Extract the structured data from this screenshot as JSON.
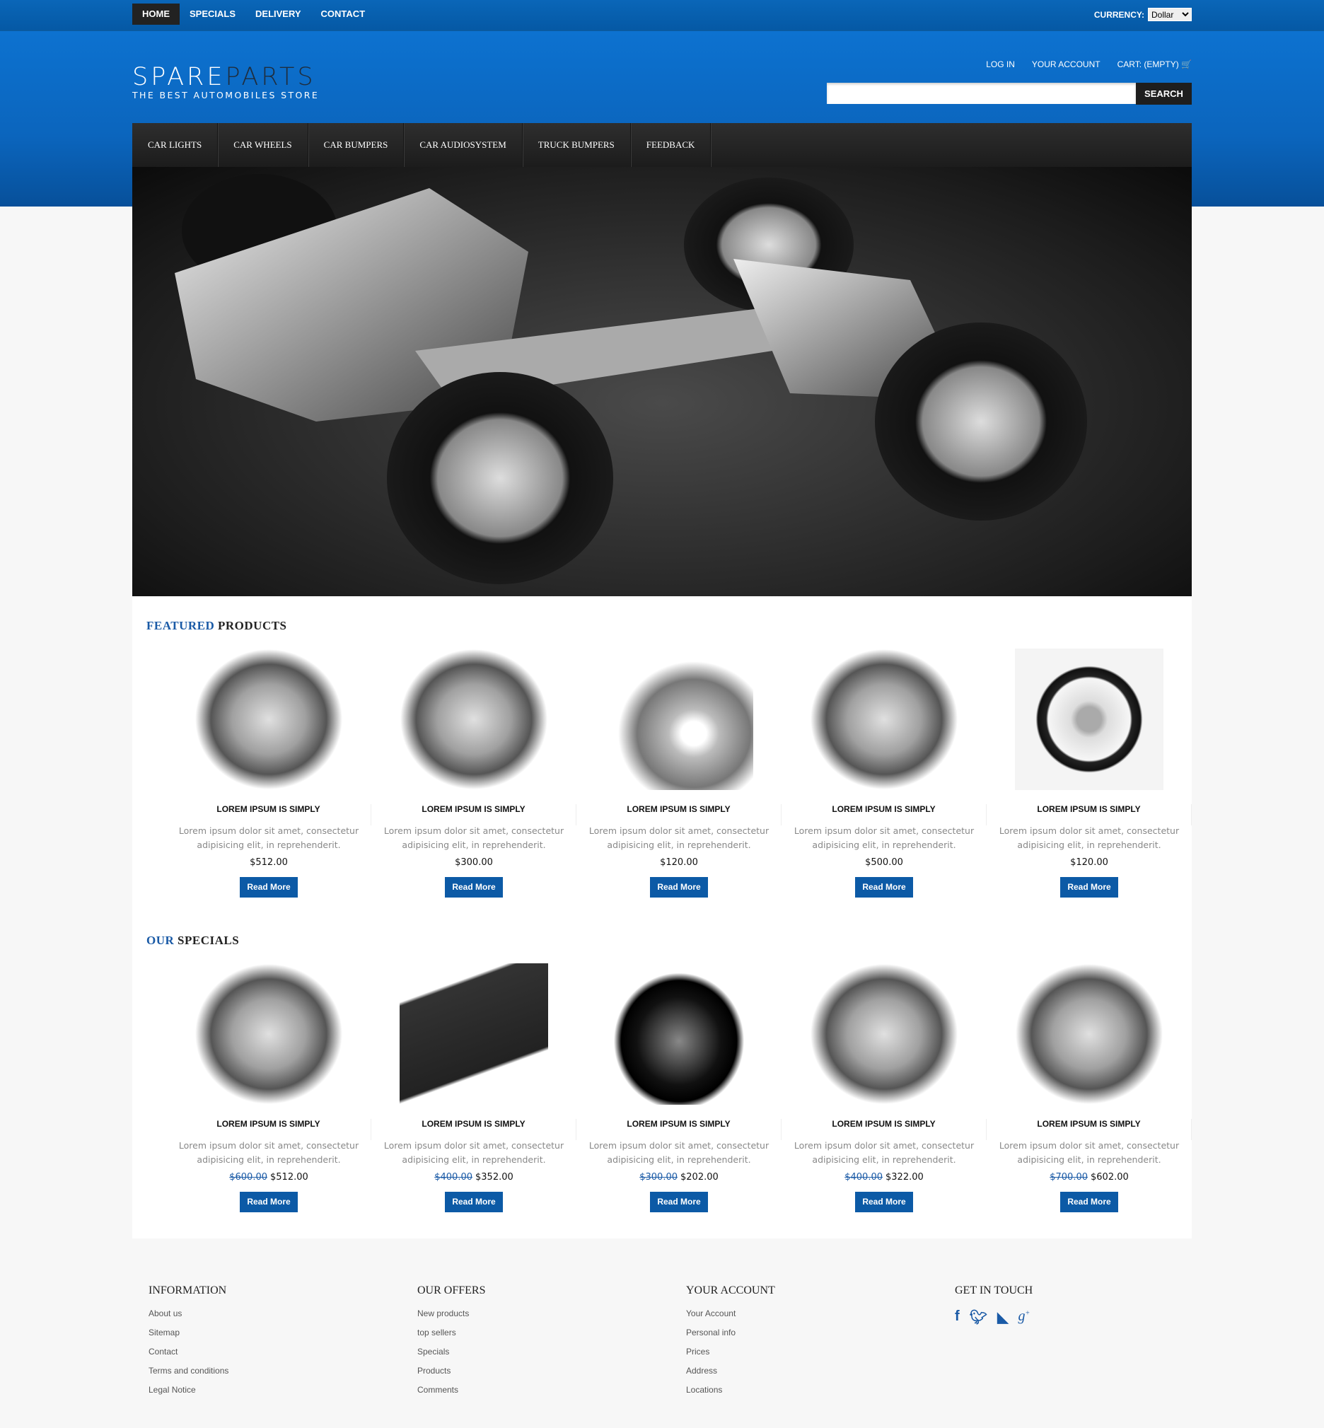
{
  "topnav": {
    "items": [
      "HOME",
      "SPECIALS",
      "DELIVERY",
      "CONTACT"
    ],
    "currency_label": "CURRENCY:",
    "currency_value": "Dollar"
  },
  "logo": {
    "spare": "SPARE",
    "parts": "PARTS",
    "tagline": "THE BEST AUTOMOBILES STORE"
  },
  "account": {
    "login": "LOG IN",
    "your_account": "YOUR ACCOUNT",
    "cart": "CART: (EMPTY)"
  },
  "search": {
    "placeholder": "",
    "button": "SEARCH"
  },
  "categories": [
    "CAR LIGHTS",
    "CAR WHEELS",
    "CAR BUMPERS",
    "CAR AUDIOSYSTEM",
    "TRUCK BUMPERS",
    "FEEDBACK"
  ],
  "featured": {
    "title_hl": "FEATURED",
    "title_rest": "PRODUCTS",
    "products": [
      {
        "title": "LOREM IPSUM IS SIMPLY",
        "desc": "Lorem ipsum dolor sit amet, consectetur adipisicing elit, in reprehenderit.",
        "price": "$512.00",
        "button": "Read More",
        "image": "engine"
      },
      {
        "title": "LOREM IPSUM IS SIMPLY",
        "desc": "Lorem ipsum dolor sit amet, consectetur adipisicing elit, in reprehenderit.",
        "price": "$300.00",
        "button": "Read More",
        "image": "engine"
      },
      {
        "title": "LOREM IPSUM IS SIMPLY",
        "desc": "Lorem ipsum dolor sit amet, consectetur adipisicing elit, in reprehenderit.",
        "price": "$120.00",
        "button": "Read More",
        "image": "brake-kit"
      },
      {
        "title": "LOREM IPSUM IS SIMPLY",
        "desc": "Lorem ipsum dolor sit amet, consectetur adipisicing elit, in reprehenderit.",
        "price": "$500.00",
        "button": "Read More",
        "image": "engine"
      },
      {
        "title": "LOREM IPSUM IS SIMPLY",
        "desc": "Lorem ipsum dolor sit amet, consectetur adipisicing elit, in reprehenderit.",
        "price": "$120.00",
        "button": "Read More",
        "image": "steering-wheel"
      }
    ]
  },
  "specials": {
    "title_hl": "OUR",
    "title_rest": "SPECIALS",
    "products": [
      {
        "title": "LOREM IPSUM IS SIMPLY",
        "desc": "Lorem ipsum dolor sit amet, consectetur adipisicing elit, in reprehenderit.",
        "old_price": "$600.00",
        "price": "$512.00",
        "button": "Read More",
        "image": "engine"
      },
      {
        "title": "LOREM IPSUM IS SIMPLY",
        "desc": "Lorem ipsum dolor sit amet, consectetur adipisicing elit, in reprehenderit.",
        "old_price": "$400.00",
        "price": "$352.00",
        "button": "Read More",
        "image": "gps"
      },
      {
        "title": "LOREM IPSUM IS SIMPLY",
        "desc": "Lorem ipsum dolor sit amet, consectetur adipisicing elit, in reprehenderit.",
        "old_price": "$300.00",
        "price": "$202.00",
        "button": "Read More",
        "image": "headlights"
      },
      {
        "title": "LOREM IPSUM IS SIMPLY",
        "desc": "Lorem ipsum dolor sit amet, consectetur adipisicing elit, in reprehenderit.",
        "old_price": "$400.00",
        "price": "$322.00",
        "button": "Read More",
        "image": "engine"
      },
      {
        "title": "LOREM IPSUM IS SIMPLY",
        "desc": "Lorem ipsum dolor sit amet, consectetur adipisicing elit, in reprehenderit.",
        "old_price": "$700.00",
        "price": "$602.00",
        "button": "Read More",
        "image": "engine"
      }
    ]
  },
  "footer": {
    "columns": [
      {
        "title": "INFORMATION",
        "links": [
          "About us",
          "Sitemap",
          "Contact",
          "Terms and conditions",
          "Legal Notice"
        ]
      },
      {
        "title": "OUR OFFERS",
        "links": [
          "New products",
          "top sellers",
          "Specials",
          "Products",
          "Comments"
        ]
      },
      {
        "title": "YOUR ACCOUNT",
        "links": [
          "Your Account",
          "Personal info",
          "Prices",
          "Address",
          "Locations"
        ]
      }
    ],
    "social_title": "GET IN TOUCH",
    "social": [
      "facebook-icon",
      "twitter-icon",
      "rss-icon",
      "google-plus-icon"
    ]
  },
  "colors": {
    "brand_blue": "#0b65bd",
    "button_blue": "#0c5aa6",
    "dark_nav": "#222222"
  }
}
